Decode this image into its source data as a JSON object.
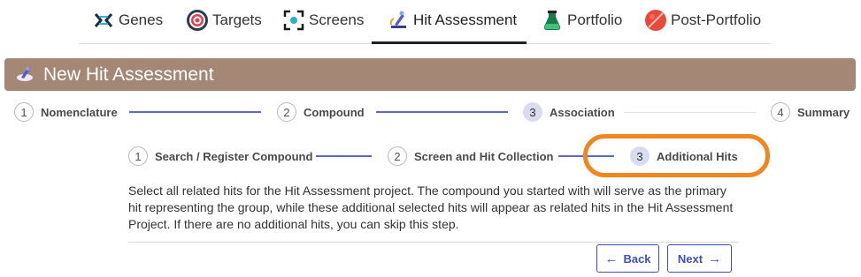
{
  "nav": {
    "items": [
      {
        "label": "Genes",
        "icon": "dna-icon"
      },
      {
        "label": "Targets",
        "icon": "target-icon"
      },
      {
        "label": "Screens",
        "icon": "screen-focus-icon"
      },
      {
        "label": "Hit Assessment",
        "icon": "microscope-icon"
      },
      {
        "label": "Portfolio",
        "icon": "flask-icon"
      },
      {
        "label": "Post-Portfolio",
        "icon": "pill-icon"
      }
    ],
    "active": "Hit Assessment"
  },
  "header": {
    "title": "New Hit Assessment",
    "icon": "microscope-icon",
    "color": "#a58776"
  },
  "main_stepper": [
    {
      "number": "1",
      "label": "Nomenclature"
    },
    {
      "number": "2",
      "label": "Compound"
    },
    {
      "number": "3",
      "label": "Association"
    },
    {
      "number": "4",
      "label": "Summary"
    }
  ],
  "sub_stepper": [
    {
      "number": "1",
      "label": "Search / Register Compound"
    },
    {
      "number": "2",
      "label": "Screen and Hit Collection"
    },
    {
      "number": "3",
      "label": "Additional Hits"
    }
  ],
  "description": "Select all related hits for the Hit Assessment project. The compound you started with will serve as the primary hit representing the group, while these additional selected hits will appear as related hits in the Hit Assessment Project. If there are no additional hits, you can skip this step.",
  "buttons": {
    "back_label": "Back",
    "back_arrow": "←",
    "next_label": "Next",
    "next_arrow": "→"
  },
  "colors": {
    "accent": "#3f51b5",
    "step_line": "#5c6bc0",
    "active_step_bg": "#d9dcef",
    "highlight": "#f0861f"
  }
}
